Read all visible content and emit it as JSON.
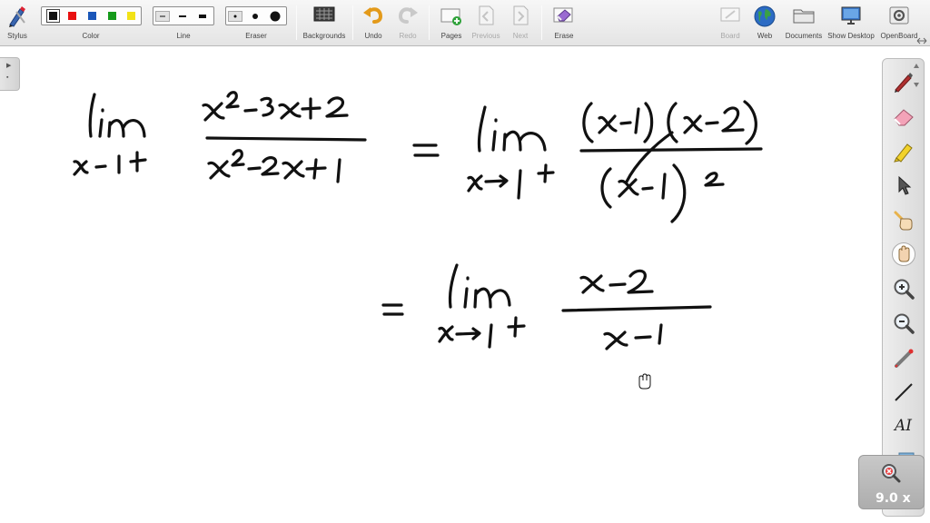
{
  "toolbar": {
    "stylus": "Stylus",
    "color": "Color",
    "line": "Line",
    "eraser": "Eraser",
    "backgrounds": "Backgrounds",
    "undo": "Undo",
    "redo": "Redo",
    "pages": "Pages",
    "previous": "Previous",
    "next": "Next",
    "erase": "Erase",
    "board": "Board",
    "web": "Web",
    "documents": "Documents",
    "show_desktop": "Show Desktop",
    "openboard": "OpenBoard"
  },
  "colors": {
    "swatches": [
      "#111111",
      "#e81010",
      "#1a56b8",
      "#159a1a",
      "#f2e216"
    ],
    "selected": "#111111",
    "accent": "#f0a020"
  },
  "zoom": {
    "level": "9.0 x"
  },
  "right_panel": {
    "tools": [
      "pen-tool-icon",
      "eraser-tool-icon",
      "marker-tool-icon",
      "selector-icon",
      "interactor-icon",
      "hand-icon",
      "zoom-in-icon",
      "zoom-out-icon",
      "laser-pointer-icon",
      "line-tool-icon",
      "text-tool-icon",
      "capture-icon"
    ],
    "text_tool_label": "AI"
  }
}
